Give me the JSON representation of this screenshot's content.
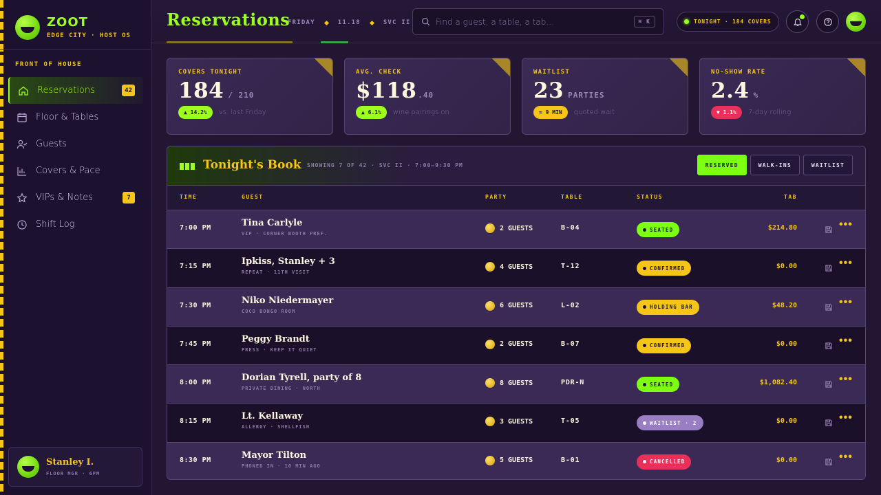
{
  "brand": {
    "name": "ZOOT",
    "sub": "EDGE CITY · HOST OS"
  },
  "nav": {
    "section": "FRONT OF HOUSE",
    "items": [
      {
        "label": "Reservations",
        "icon": "home-icon",
        "badge": "42"
      },
      {
        "label": "Floor & Tables",
        "icon": "calendar-icon",
        "badge": ""
      },
      {
        "label": "Guests",
        "icon": "user-check-icon",
        "badge": ""
      },
      {
        "label": "Covers & Pace",
        "icon": "bar-chart-icon",
        "badge": ""
      },
      {
        "label": "VIPs & Notes",
        "icon": "star-icon",
        "badge": "7"
      },
      {
        "label": "Shift Log",
        "icon": "clock-icon",
        "badge": ""
      }
    ]
  },
  "user": {
    "name": "Stanley I.",
    "role": "FLOOR MGR · 6PM"
  },
  "header": {
    "title": "Reservations",
    "day": "FRIDAY",
    "date": "11.18",
    "service": "SVC II",
    "search_placeholder": "Find a guest, a table, a tab...",
    "search_shortcut": "⌘ K",
    "tonight": "TONIGHT · 184 COVERS"
  },
  "stats": [
    {
      "label": "COVERS TONIGHT",
      "value": "184",
      "suffix": "/ 210",
      "delta": "▲ 14.2%",
      "delta_kind": "up",
      "note": "vs. last Friday"
    },
    {
      "label": "AVG. CHECK",
      "value": "$118",
      "suffix": ".40",
      "delta": "▲ 6.1%",
      "delta_kind": "up",
      "note": "wine pairings on"
    },
    {
      "label": "WAITLIST",
      "value": "23",
      "suffix": "PARTIES",
      "delta": "≈ 9 MIN",
      "delta_kind": "warn",
      "note": "quoted wait"
    },
    {
      "label": "NO-SHOW RATE",
      "value": "2.4",
      "suffix": "%",
      "delta": "▼ 1.1%",
      "delta_kind": "down",
      "note": "7-day rolling"
    }
  ],
  "book": {
    "title": "Tonight's Book",
    "subtitle": "SHOWING 7 OF 42 · SVC II · 7:00–9:30 PM",
    "filters": [
      "RESERVED",
      "WALK-INS",
      "WAITLIST"
    ],
    "columns": {
      "time": "TIME",
      "guest": "GUEST",
      "party": "PARTY",
      "table": "TABLE",
      "status": "STATUS",
      "tab": "TAB"
    },
    "rows": [
      {
        "time": "7:00 PM",
        "name": "Tina Carlyle",
        "note": "VIP · CORNER BOOTH PREF.",
        "party": "2 GUESTS",
        "table": "B-04",
        "status": "SEATED",
        "status_kind": "seated",
        "tab": "$214.80"
      },
      {
        "time": "7:15 PM",
        "name": "Ipkiss, Stanley + 3",
        "note": "REPEAT · 11TH VISIT",
        "party": "4 GUESTS",
        "table": "T-12",
        "status": "CONFIRMED",
        "status_kind": "confirmed",
        "tab": "$0.00"
      },
      {
        "time": "7:30 PM",
        "name": "Niko Niedermayer",
        "note": "COCO BONGO ROOM",
        "party": "6 GUESTS",
        "table": "L-02",
        "status": "HOLDING BAR",
        "status_kind": "holding",
        "tab": "$48.20"
      },
      {
        "time": "7:45 PM",
        "name": "Peggy Brandt",
        "note": "PRESS · KEEP IT QUIET",
        "party": "2 GUESTS",
        "table": "B-07",
        "status": "CONFIRMED",
        "status_kind": "confirmed",
        "tab": "$0.00"
      },
      {
        "time": "8:00 PM",
        "name": "Dorian Tyrell, party of 8",
        "note": "PRIVATE DINING · NORTH",
        "party": "8 GUESTS",
        "table": "PDR-N",
        "status": "SEATED",
        "status_kind": "seated",
        "tab": "$1,082.40"
      },
      {
        "time": "8:15 PM",
        "name": "Lt. Kellaway",
        "note": "ALLERGY · SHELLFISH",
        "party": "3 GUESTS",
        "table": "T-05",
        "status": "WAITLIST · 2",
        "status_kind": "waitlist",
        "tab": "$0.00"
      },
      {
        "time": "8:30 PM",
        "name": "Mayor Tilton",
        "note": "PHONED IN · 10 MIN AGO",
        "party": "5 GUESTS",
        "table": "B-01",
        "status": "CANCELLED",
        "status_kind": "cancelled",
        "tab": "$0.00"
      }
    ]
  },
  "colors": {
    "accent": "#9cff1e",
    "gold": "#f5c518",
    "danger": "#e8305a",
    "bg": "#221633"
  }
}
